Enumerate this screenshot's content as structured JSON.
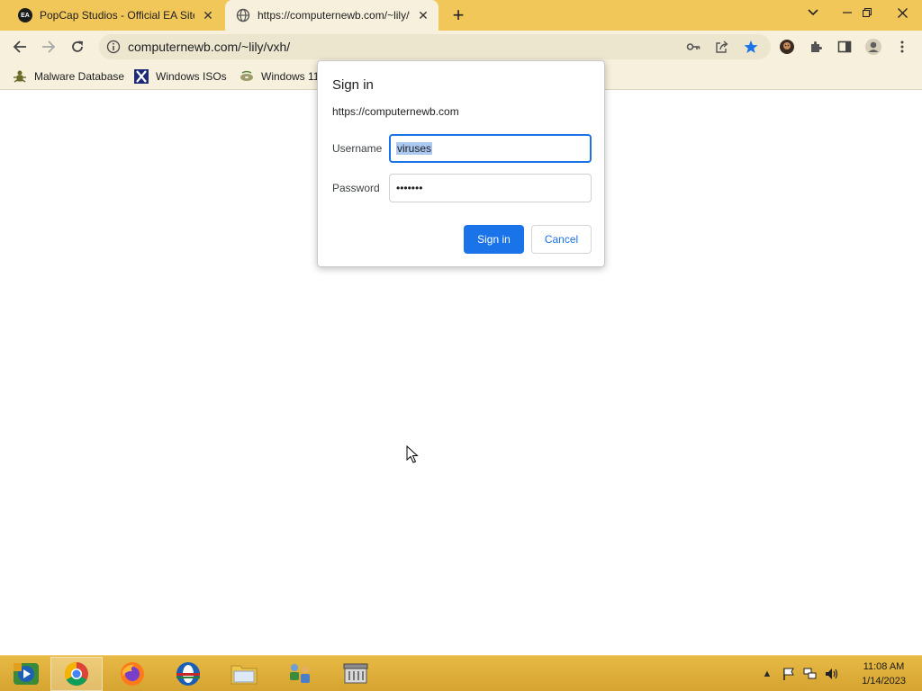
{
  "tabs": [
    {
      "title": "PopCap Studios - Official EA Site",
      "favicon": "ea-logo-icon"
    },
    {
      "title": "https://computernewb.com/~lily/vxh/",
      "favicon": "globe-icon"
    }
  ],
  "toolbar": {
    "url": "computernewb.com/~lily/vxh/"
  },
  "bookmarks": [
    {
      "label": "Malware Database",
      "icon": "bug-icon"
    },
    {
      "label": "Windows ISOs",
      "icon": "x-logo-icon"
    },
    {
      "label": "Windows 11",
      "icon": "disc-icon"
    }
  ],
  "dialog": {
    "title": "Sign in",
    "origin": "https://computernewb.com",
    "username_label": "Username",
    "username_value": "viruses",
    "password_label": "Password",
    "password_value": "•••••••",
    "signin_label": "Sign in",
    "cancel_label": "Cancel"
  },
  "taskbar": {
    "apps": [
      "windows-media-center-icon",
      "chrome-icon",
      "firefox-icon",
      "opera-icon",
      "file-explorer-icon",
      "network-users-icon",
      "archive-icon"
    ],
    "time": "11:08 AM",
    "date": "1/14/2023"
  },
  "colors": {
    "accent": "#1a73e8",
    "frame": "#f2c75a",
    "toolbar": "#f6f0dc",
    "taskbar": "#e0ae3a"
  }
}
